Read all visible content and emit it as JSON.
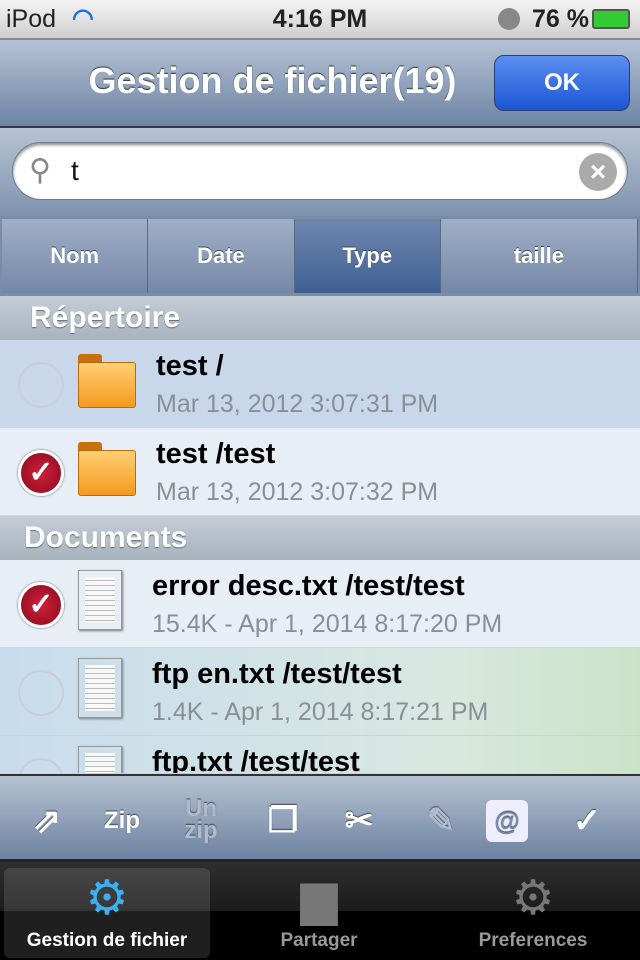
{
  "status": {
    "carrier": "iPod",
    "time": "4:16 PM",
    "battery": "76 %",
    "battery_level": 0.76
  },
  "nav": {
    "title": "Gestion de fichier(19)",
    "ok": "OK"
  },
  "search": {
    "value": "t"
  },
  "sort": {
    "options": [
      "Nom",
      "Date",
      "Type",
      "taille"
    ],
    "selected": "Type"
  },
  "sections": [
    {
      "title": "Répertoire",
      "items": [
        {
          "name": "test /",
          "detail": "Mar 13, 2012 3:07:31 PM",
          "checked": false
        },
        {
          "name": "test /test",
          "detail": "Mar 13, 2012 3:07:32 PM",
          "checked": true
        }
      ]
    },
    {
      "title": "Documents",
      "items": [
        {
          "name": "error desc.txt /test/test",
          "detail": "15.4K - Apr 1, 2014 8:17:20 PM",
          "checked": true
        },
        {
          "name": "ftp en.txt /test/test",
          "detail": "1.4K - Apr 1, 2014 8:17:21 PM",
          "checked": false
        },
        {
          "name": "ftp.txt /test/test",
          "checked": false
        }
      ]
    }
  ],
  "toolbar": {
    "zip": "Zip",
    "unzip_top": "Un",
    "unzip_bottom": "zip",
    "icons": [
      "share-icon",
      "zip",
      "unzip",
      "copy-icon",
      "cut-icon",
      "edit-icon",
      "email-icon",
      "select-all-icon"
    ]
  },
  "tabs": [
    {
      "label": "Gestion de fichier",
      "active": true
    },
    {
      "label": "Partager",
      "active": false
    },
    {
      "label": "Preferences",
      "active": false
    }
  ]
}
